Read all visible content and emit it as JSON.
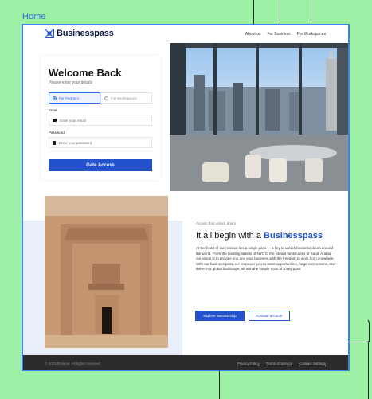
{
  "page_label": "Home",
  "brand": {
    "name": "Businesspass"
  },
  "nav": {
    "links": [
      "About us",
      "For Business",
      "For Workspaces"
    ]
  },
  "login": {
    "title": "Welcome Back",
    "subtitle": "Please enter your details",
    "options": [
      "For Partners",
      "For Workspaces"
    ],
    "selected_option": "For Partners",
    "email_label": "Email",
    "email_placeholder": "Enter your email",
    "password_label": "Password",
    "password_placeholder": "Enter your password",
    "submit_label": "Gate Access"
  },
  "promo": {
    "kicker": "Access that unlock doors",
    "headline_prefix": "It all begin with a ",
    "headline_brand": "Businesspass",
    "body": "At the heart of our mission lies a single pass — a key to unlock business doors around the world. From the bustling streets of NYC to the vibrant landscapes of Saudi Arabia, our vision is to provide you and your business with the freedom to work from anywhere. With our business pass, we empower you to seize opportunities, forge connections, and thrive in a global landscape, all with the simple scan of a key pass.",
    "primary_button": "Explore Membership",
    "secondary_button": "Activate account"
  },
  "footer": {
    "copyright": "© 2023 Rolume. All rights reserved.",
    "links": [
      "Privacy Policy",
      "Terms of Service",
      "Cookies Settings"
    ]
  },
  "colors": {
    "accent": "#2352cc",
    "frame_border": "#3b82f6",
    "background": "#9ef0a6",
    "footer": "#2b2b2b"
  },
  "icons": [
    "businesspass-logo-icon",
    "radio-icon",
    "mail-icon",
    "lock-icon"
  ]
}
